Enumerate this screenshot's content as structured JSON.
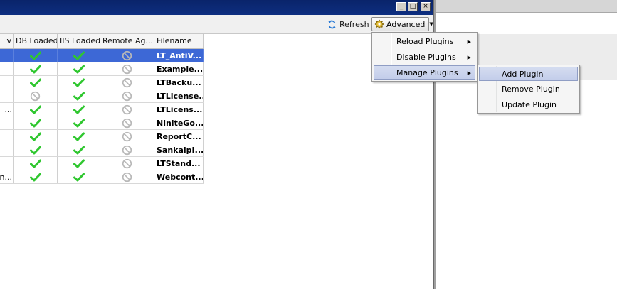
{
  "toolbar": {
    "refresh_label": "Refresh",
    "advanced_label": "Advanced"
  },
  "caption_buttons": {
    "minimize": "_",
    "maximize": "□",
    "close": "×"
  },
  "grid": {
    "columns": [
      "v",
      "DB Loaded",
      "IIS Loaded",
      "Remote Ag...",
      "Filename"
    ],
    "rows": [
      {
        "col1": "",
        "db": "check",
        "iis": "check",
        "remote": "disabled",
        "filename": "LT_AntiV...",
        "selected": true
      },
      {
        "col1": "",
        "db": "check",
        "iis": "check",
        "remote": "disabled",
        "filename": "Example...",
        "selected": false
      },
      {
        "col1": "",
        "db": "check",
        "iis": "check",
        "remote": "disabled",
        "filename": "LTBacku...",
        "selected": false
      },
      {
        "col1": "",
        "db": "disabled",
        "iis": "check",
        "remote": "disabled",
        "filename": "LTLicense...",
        "selected": false
      },
      {
        "col1": "...",
        "db": "check",
        "iis": "check",
        "remote": "disabled",
        "filename": "LTLicens...",
        "selected": false
      },
      {
        "col1": "",
        "db": "check",
        "iis": "check",
        "remote": "disabled",
        "filename": "NiniteGo....",
        "selected": false
      },
      {
        "col1": "",
        "db": "check",
        "iis": "check",
        "remote": "disabled",
        "filename": "ReportC...",
        "selected": false
      },
      {
        "col1": "",
        "db": "check",
        "iis": "check",
        "remote": "disabled",
        "filename": "SankalpI...",
        "selected": false
      },
      {
        "col1": "",
        "db": "check",
        "iis": "check",
        "remote": "disabled",
        "filename": "LTStand...",
        "selected": false
      },
      {
        "col1": "n...",
        "db": "check",
        "iis": "check",
        "remote": "disabled",
        "filename": "Webcont...",
        "selected": false
      }
    ]
  },
  "advanced_menu": {
    "items": [
      {
        "label": "Reload Plugins",
        "submenu": true,
        "highlighted": false
      },
      {
        "label": "Disable Plugins",
        "submenu": true,
        "highlighted": false
      },
      {
        "label": "Manage Plugins",
        "submenu": true,
        "highlighted": true
      }
    ]
  },
  "manage_submenu": {
    "items": [
      {
        "label": "Add Plugin",
        "highlighted": true
      },
      {
        "label": "Remove Plugin",
        "highlighted": false
      },
      {
        "label": "Update Plugin",
        "highlighted": false
      }
    ]
  },
  "colors": {
    "titlebar": "#0a246a",
    "selection": "#3d68d6",
    "check": "#2fc72f",
    "disabled_icon": "#b8b8b8",
    "menu_highlight": "#c8d1ec"
  }
}
